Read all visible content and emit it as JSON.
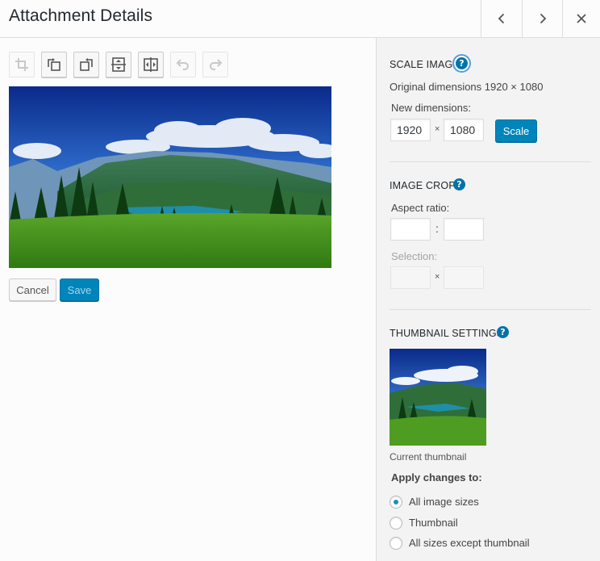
{
  "header": {
    "title": "Attachment Details",
    "prev_icon": "chevron-left-icon",
    "next_icon": "chevron-right-icon",
    "close_icon": "close-icon"
  },
  "toolbar": {
    "tools": [
      {
        "icon": "crop-icon",
        "enabled": false
      },
      {
        "icon": "rotate-left-icon",
        "enabled": true
      },
      {
        "icon": "rotate-right-icon",
        "enabled": true
      },
      {
        "icon": "flip-vertical-icon",
        "enabled": true
      },
      {
        "icon": "flip-horizontal-icon",
        "enabled": true
      },
      {
        "icon": "undo-icon",
        "enabled": false
      },
      {
        "icon": "redo-icon",
        "enabled": false
      }
    ]
  },
  "actions": {
    "cancel_label": "Cancel",
    "save_label": "Save"
  },
  "scale": {
    "title": "Scale Image",
    "original": "Original dimensions 1920 × 1080",
    "new_label": "New dimensions:",
    "width": "1920",
    "height": "1080",
    "times": "×",
    "button": "Scale"
  },
  "crop": {
    "title": "Image Crop",
    "aspect_label": "Aspect ratio:",
    "aspect_sep": ":",
    "aspect_w": "",
    "aspect_h": "",
    "selection_label": "Selection:",
    "selection_sep": "×",
    "selection_w": "",
    "selection_h": ""
  },
  "thumbnail": {
    "title": "Thumbnail Settings",
    "caption": "Current thumbnail",
    "apply_label": "Apply changes to:",
    "options": [
      {
        "label": "All image sizes",
        "selected": true
      },
      {
        "label": "Thumbnail",
        "selected": false
      },
      {
        "label": "All sizes except thumbnail",
        "selected": false
      }
    ]
  },
  "help_glyph": "?",
  "colors": {
    "accent": "#0085ba",
    "help": "#0073aa"
  }
}
